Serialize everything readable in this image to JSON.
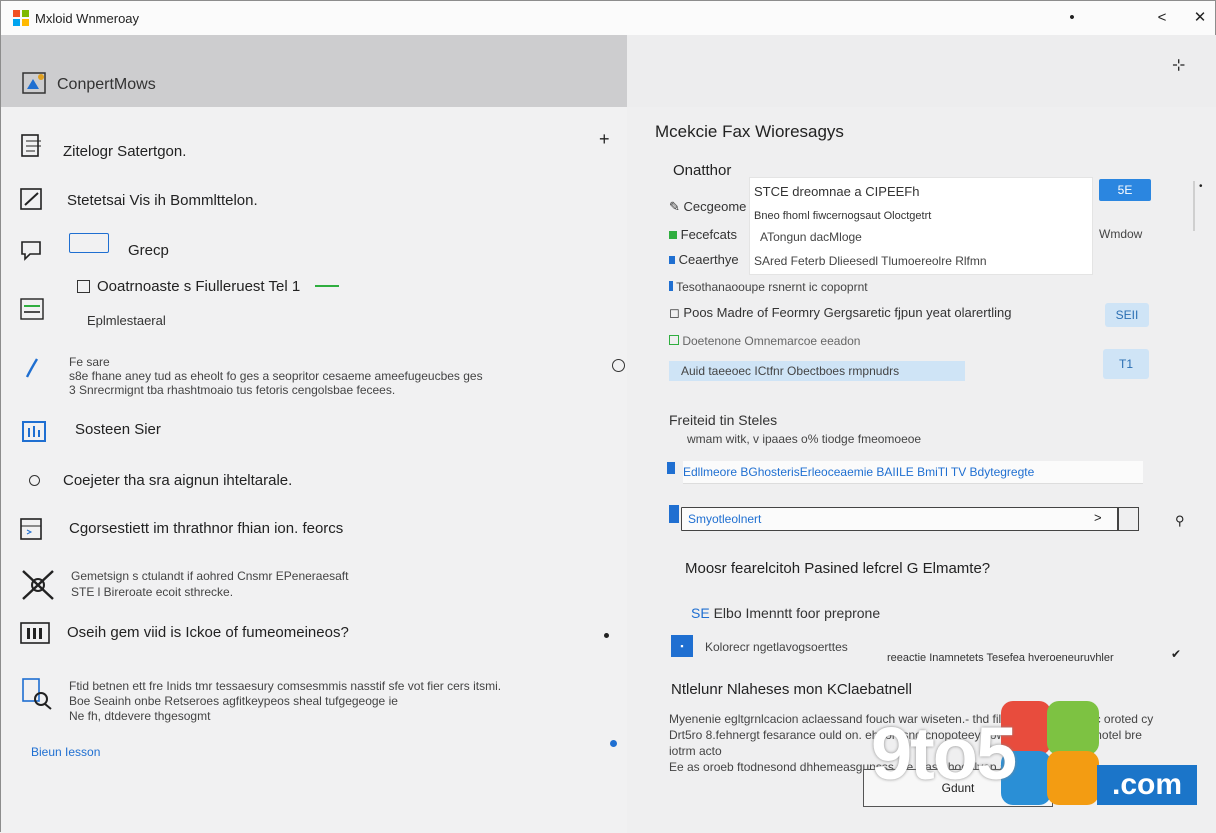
{
  "window": {
    "title": "Mxloid Wnmeroay"
  },
  "controls": {
    "minimize": "•",
    "restore": "<",
    "close": "✕"
  },
  "left": {
    "header": "ConpertMows",
    "items": [
      {
        "label": "Zitelogr Satertgon.",
        "icon": "document-icon"
      },
      {
        "label": "Stetetsai Vis ih Bommlttelon.",
        "icon": "edit-icon"
      },
      {
        "label": "Grecp",
        "icon": "comment-icon"
      },
      {
        "label": "Ooatrnoaste s Fiulleruest Tel 1",
        "icon": "checkbox-icon"
      },
      {
        "label": "Eplmlestaeral",
        "icon": "list-icon"
      },
      {
        "label": "Fe sare",
        "icon": "pen-icon"
      },
      {
        "label": "Sosteen Sier",
        "icon": "chart-icon"
      },
      {
        "label": "Coejeter tha sra aignun ihteltarale.",
        "icon": "circle-icon"
      },
      {
        "label": "Cgorsestiett im thrathnor fhian ion. feorcs",
        "icon": "window-icon"
      },
      {
        "label": "Oseih gem viid is Ickoe of fumeomeineos?",
        "icon": "calendar-icon"
      }
    ],
    "para1": [
      "Fe sare",
      "s8e fhane aney tud as eheolt fo ges a seopritor cesaeme ameefugeucbes ges",
      "3 Snrecrmignt tba rhashtmoaio tus fetoris cengolsbae fecees."
    ],
    "para2": [
      "Gemetsign s ctulandt if aohred Cnsmr EPeneraesaft",
      "STE l Bireroate ecoit sthrecke."
    ],
    "para3": [
      "Ftid betnen ett fre Inids tmr tessaesury comsesmmis nasstif sfe vot fier cers itsmi.",
      "Boe Seainh onbe Retseroes agfitkeypeos sheal tufgegeoge ie",
      "Ne fh, dtdevere thgesogmt"
    ],
    "footer_link": "Bieun Iesson"
  },
  "right": {
    "header_icon": "pin-icon",
    "title": "Mcekcie Fax Wioresagys",
    "section1": "Onatthor",
    "card": [
      "STCE dreomnae a CIPEEFh",
      "Bneo fhoml fiwcernogsaut Oloctgetrt",
      "ATongun dacMloge",
      "SAred Feterb Dlieesedl Tlumoereolre Rlfmn"
    ],
    "rows": [
      {
        "label": "Cecgeome",
        "icon": "pencil-icon"
      },
      {
        "label": "Fecefcats",
        "icon": "green-flag-icon"
      },
      {
        "label": "Ceaerthye",
        "icon": "blue-flag-icon"
      },
      {
        "label": "Tesothanaooupe rsnernt ic copoprnt",
        "icon": "blue-bar-icon"
      },
      {
        "label": "Poos Madre of Feormry Gergsaretic fjpun yeat olarertling",
        "icon": "radio-icon"
      },
      {
        "label": "Doetenone Omnemarcoe eeadon",
        "icon": "green-box-icon"
      }
    ],
    "blue_btn": "5E",
    "windows_label": "Wmdow",
    "btn_small1": "SEII",
    "btn_small2": "T1",
    "highlight_bar": "Auid taeeoec ICtfnr Obectboes rmpnudrs",
    "section2_title": "Freiteid tin Steles",
    "section2_sub": "wmam witk, v ipaaes o% tiodge fmeomoeoe",
    "tab_row": "Edllmeore BGhosterisErleoceaemie BAIILE BmiTl TV Bdytegregte",
    "input_value": "Smyotleolnert",
    "question": "Moosr fearelcitoh Pasined lefcrel G Elmamte?",
    "option_prefix": "SE",
    "option_label": "Elbo Imenntt foor preprone",
    "list_item": "Kolorecr ngetlavogsoerttes",
    "right_note": "reeactie Inamnetets Tesefea hveroeneuruvhler",
    "section3_title": "Ntlelunr Nlaheses mon KClaebatnell",
    "section3_text": [
      "Myenenie egltgrnlcacion aclaessand fouch war wiseten.- thd fil sooaewteeloe fluc oroted cy",
      "Drt5ro 8.fehnergt fesarance ould on. ehaoresnd cnopoteey vow oatinn ccaclm amotel bre iotrm acto",
      "Ee as oroeb ftodnesond dhhemeasgunsss ste slasa hoddlvep asteneronrd te as."
    ],
    "ok_button": "Gdunt"
  },
  "watermark": {
    "digits": "9to5",
    "suffix": ".com"
  },
  "colors": {
    "accent": "#2b86e0",
    "light_accent": "#cfe4f6",
    "header_gray": "#cdcdcf"
  }
}
